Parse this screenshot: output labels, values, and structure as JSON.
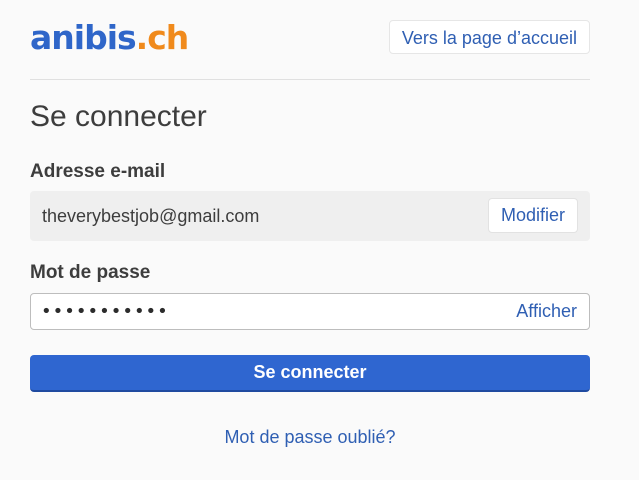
{
  "header": {
    "logo_main": "anibis",
    "logo_suffix": ".ch",
    "home_link_label": "Vers la page d’accueil"
  },
  "login": {
    "title": "Se connecter",
    "email_label": "Adresse e-mail",
    "email_value": "theverybestjob@gmail.com",
    "modify_label": "Modifier",
    "password_label": "Mot de passe",
    "password_value": "•••••••••••",
    "show_label": "Afficher",
    "submit_label": "Se connecter",
    "forgot_label": "Mot de passe oublié?"
  },
  "colors": {
    "brand_blue": "#2f66c9",
    "brand_orange": "#f08a1c",
    "primary_button": "#2f66d0",
    "link": "#2f5fb3"
  }
}
